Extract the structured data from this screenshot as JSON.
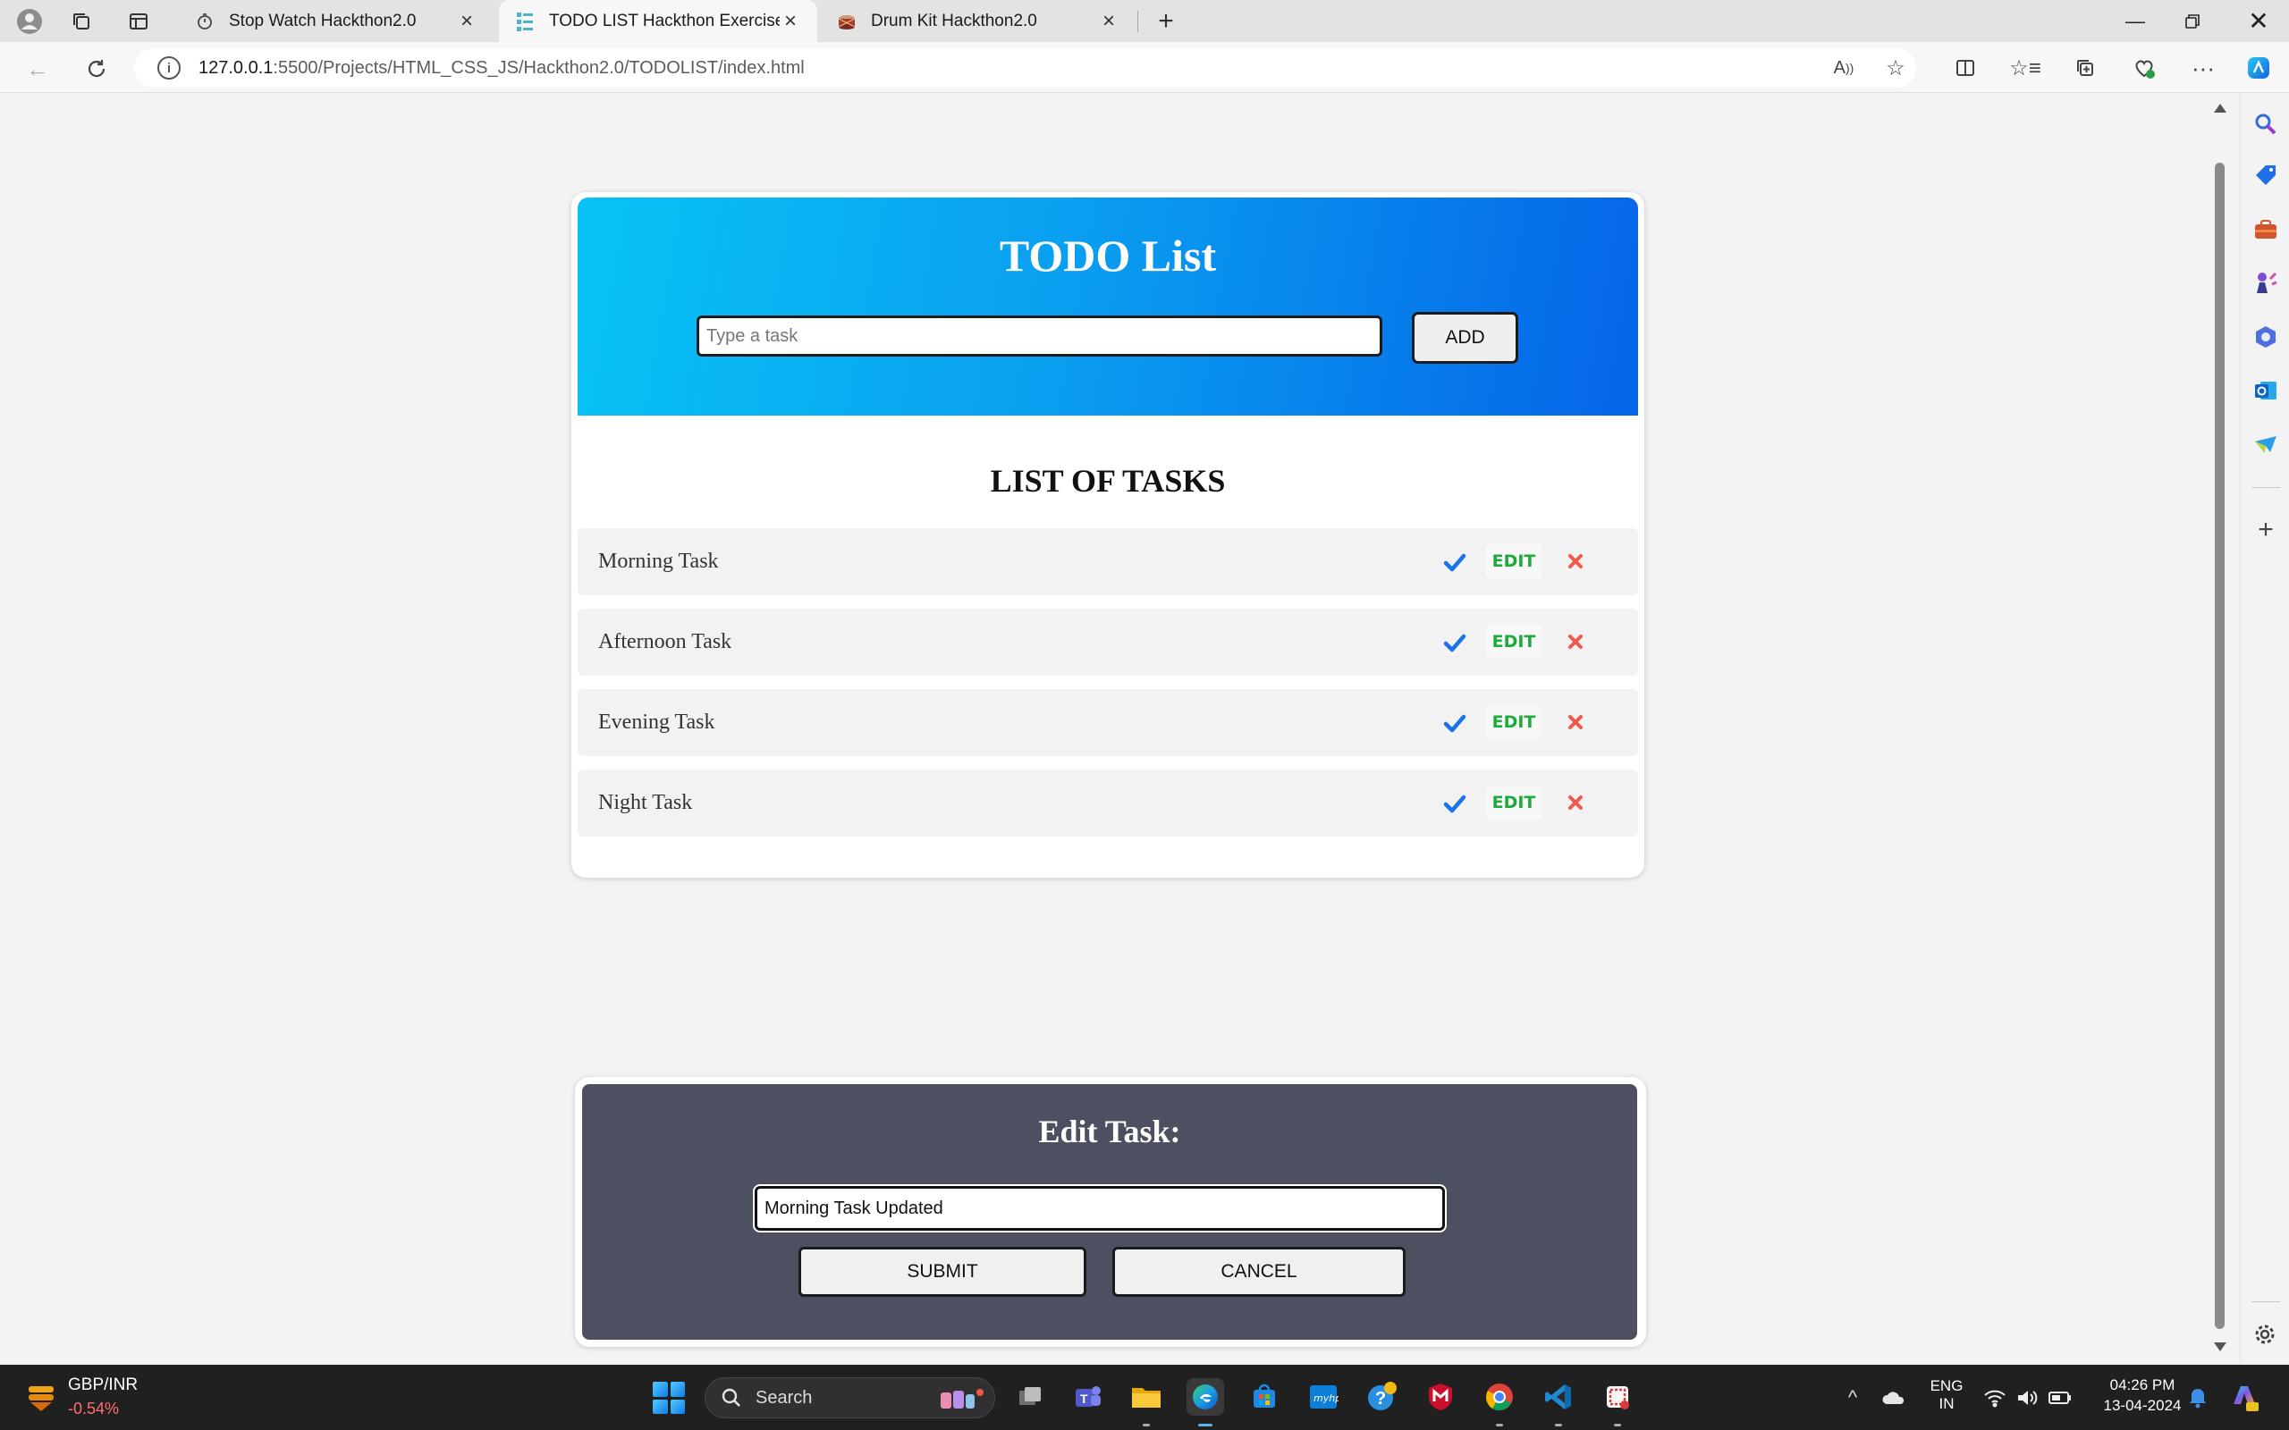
{
  "browser": {
    "tabs": [
      {
        "title": "Stop Watch Hackthon2.0",
        "icon": "stopwatch-icon"
      },
      {
        "title": "TODO LIST Hackthon Exercise",
        "icon": "list-icon",
        "active": true
      },
      {
        "title": "Drum Kit Hackthon2.0",
        "icon": "drum-icon"
      }
    ],
    "url_host": "127.0.0.1",
    "url_path": ":5500/Projects/HTML_CSS_JS/Hackthon2.0/TODOLIST/index.html"
  },
  "todo": {
    "title": "TODO List",
    "input_placeholder": "Type a task",
    "add_label": "ADD",
    "list_heading": "LIST OF TASKS",
    "tasks": [
      {
        "name": "Morning Task",
        "edit_label": "EDIT"
      },
      {
        "name": "Afternoon Task",
        "edit_label": "EDIT"
      },
      {
        "name": "Evening Task",
        "edit_label": "EDIT"
      },
      {
        "name": "Night Task",
        "edit_label": "EDIT"
      }
    ],
    "colors": {
      "header_start": "#08c3f5",
      "header_end": "#0564e8",
      "check": "#1a73e8",
      "edit": "#1eab3c",
      "delete": "#f2594b"
    }
  },
  "edit_panel": {
    "title": "Edit Task:",
    "input_value": "Morning Task Updated",
    "submit_label": "SUBMIT",
    "cancel_label": "CANCEL"
  },
  "taskbar": {
    "widget_label": "GBP/INR",
    "widget_change": "-0.54%",
    "search_label": "Search",
    "lang_line1": "ENG",
    "lang_line2": "IN",
    "time": "04:26 PM",
    "date": "13-04-2024"
  }
}
